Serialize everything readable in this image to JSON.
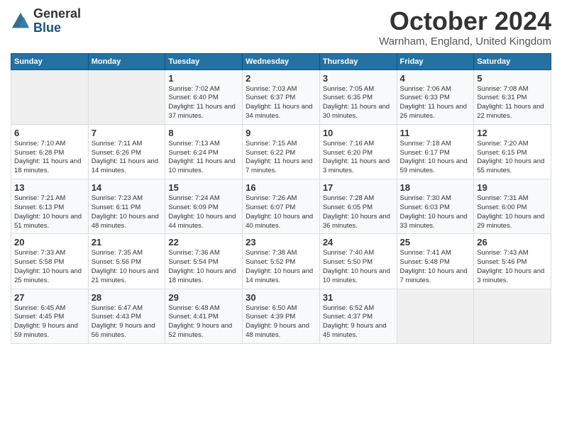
{
  "logo": {
    "general": "General",
    "blue": "Blue"
  },
  "title": "October 2024",
  "location": "Warnham, England, United Kingdom",
  "days_of_week": [
    "Sunday",
    "Monday",
    "Tuesday",
    "Wednesday",
    "Thursday",
    "Friday",
    "Saturday"
  ],
  "weeks": [
    [
      {
        "day": "",
        "info": ""
      },
      {
        "day": "",
        "info": ""
      },
      {
        "day": "1",
        "info": "Sunrise: 7:02 AM\nSunset: 6:40 PM\nDaylight: 11 hours and 37 minutes."
      },
      {
        "day": "2",
        "info": "Sunrise: 7:03 AM\nSunset: 6:37 PM\nDaylight: 11 hours and 34 minutes."
      },
      {
        "day": "3",
        "info": "Sunrise: 7:05 AM\nSunset: 6:35 PM\nDaylight: 11 hours and 30 minutes."
      },
      {
        "day": "4",
        "info": "Sunrise: 7:06 AM\nSunset: 6:33 PM\nDaylight: 11 hours and 26 minutes."
      },
      {
        "day": "5",
        "info": "Sunrise: 7:08 AM\nSunset: 6:31 PM\nDaylight: 11 hours and 22 minutes."
      }
    ],
    [
      {
        "day": "6",
        "info": "Sunrise: 7:10 AM\nSunset: 6:28 PM\nDaylight: 11 hours and 18 minutes."
      },
      {
        "day": "7",
        "info": "Sunrise: 7:11 AM\nSunset: 6:26 PM\nDaylight: 11 hours and 14 minutes."
      },
      {
        "day": "8",
        "info": "Sunrise: 7:13 AM\nSunset: 6:24 PM\nDaylight: 11 hours and 10 minutes."
      },
      {
        "day": "9",
        "info": "Sunrise: 7:15 AM\nSunset: 6:22 PM\nDaylight: 11 hours and 7 minutes."
      },
      {
        "day": "10",
        "info": "Sunrise: 7:16 AM\nSunset: 6:20 PM\nDaylight: 11 hours and 3 minutes."
      },
      {
        "day": "11",
        "info": "Sunrise: 7:18 AM\nSunset: 6:17 PM\nDaylight: 10 hours and 59 minutes."
      },
      {
        "day": "12",
        "info": "Sunrise: 7:20 AM\nSunset: 6:15 PM\nDaylight: 10 hours and 55 minutes."
      }
    ],
    [
      {
        "day": "13",
        "info": "Sunrise: 7:21 AM\nSunset: 6:13 PM\nDaylight: 10 hours and 51 minutes."
      },
      {
        "day": "14",
        "info": "Sunrise: 7:23 AM\nSunset: 6:11 PM\nDaylight: 10 hours and 48 minutes."
      },
      {
        "day": "15",
        "info": "Sunrise: 7:24 AM\nSunset: 6:09 PM\nDaylight: 10 hours and 44 minutes."
      },
      {
        "day": "16",
        "info": "Sunrise: 7:26 AM\nSunset: 6:07 PM\nDaylight: 10 hours and 40 minutes."
      },
      {
        "day": "17",
        "info": "Sunrise: 7:28 AM\nSunset: 6:05 PM\nDaylight: 10 hours and 36 minutes."
      },
      {
        "day": "18",
        "info": "Sunrise: 7:30 AM\nSunset: 6:03 PM\nDaylight: 10 hours and 33 minutes."
      },
      {
        "day": "19",
        "info": "Sunrise: 7:31 AM\nSunset: 6:00 PM\nDaylight: 10 hours and 29 minutes."
      }
    ],
    [
      {
        "day": "20",
        "info": "Sunrise: 7:33 AM\nSunset: 5:58 PM\nDaylight: 10 hours and 25 minutes."
      },
      {
        "day": "21",
        "info": "Sunrise: 7:35 AM\nSunset: 5:56 PM\nDaylight: 10 hours and 21 minutes."
      },
      {
        "day": "22",
        "info": "Sunrise: 7:36 AM\nSunset: 5:54 PM\nDaylight: 10 hours and 18 minutes."
      },
      {
        "day": "23",
        "info": "Sunrise: 7:38 AM\nSunset: 5:52 PM\nDaylight: 10 hours and 14 minutes."
      },
      {
        "day": "24",
        "info": "Sunrise: 7:40 AM\nSunset: 5:50 PM\nDaylight: 10 hours and 10 minutes."
      },
      {
        "day": "25",
        "info": "Sunrise: 7:41 AM\nSunset: 5:48 PM\nDaylight: 10 hours and 7 minutes."
      },
      {
        "day": "26",
        "info": "Sunrise: 7:43 AM\nSunset: 5:46 PM\nDaylight: 10 hours and 3 minutes."
      }
    ],
    [
      {
        "day": "27",
        "info": "Sunrise: 6:45 AM\nSunset: 4:45 PM\nDaylight: 9 hours and 59 minutes."
      },
      {
        "day": "28",
        "info": "Sunrise: 6:47 AM\nSunset: 4:43 PM\nDaylight: 9 hours and 56 minutes."
      },
      {
        "day": "29",
        "info": "Sunrise: 6:48 AM\nSunset: 4:41 PM\nDaylight: 9 hours and 52 minutes."
      },
      {
        "day": "30",
        "info": "Sunrise: 6:50 AM\nSunset: 4:39 PM\nDaylight: 9 hours and 48 minutes."
      },
      {
        "day": "31",
        "info": "Sunrise: 6:52 AM\nSunset: 4:37 PM\nDaylight: 9 hours and 45 minutes."
      },
      {
        "day": "",
        "info": ""
      },
      {
        "day": "",
        "info": ""
      }
    ]
  ]
}
